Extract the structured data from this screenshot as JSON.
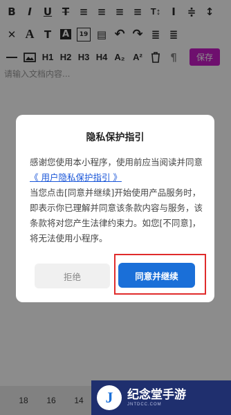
{
  "toolbar": {
    "row1": [
      "B",
      "I",
      "U",
      "T",
      "≡",
      "≡",
      "≡",
      "≡",
      "T↕",
      "I",
      "≑",
      "↕"
    ],
    "row2": [
      "✕",
      "A",
      "T",
      "A",
      "19",
      "▤",
      "↶",
      "↷",
      "≣",
      "≣"
    ],
    "row3_labels": [
      "H1",
      "H2",
      "H3",
      "H4",
      "A₂",
      "A²",
      "¶"
    ],
    "save_label": "保存"
  },
  "editor": {
    "placeholder": "请输入文档内容..."
  },
  "bottom_bar": {
    "sizes": [
      "18",
      "16",
      "14"
    ]
  },
  "dialog": {
    "title": "隐私保护指引",
    "intro_text": "感谢您使用本小程序，使用前应当阅读并同意",
    "policy_link": "《 用户隐私保护指引 》",
    "body_text": "当您点击[同意并继续]开始使用产品服务时，即表示你已理解并同意该条款内容与服务，该条款将对您产生法律约束力。如您[不同意]，将无法使用小程序。",
    "reject_label": "拒绝",
    "agree_label": "同意并继续"
  },
  "watermark": {
    "logo_letter": "J",
    "text": "纪念堂手游",
    "sub": "JNTDCC.COM"
  },
  "colors": {
    "save_button": "#c91cc9",
    "agree_button": "#1a6fd8",
    "link": "#1a56d8",
    "highlight": "#e02b2b"
  }
}
